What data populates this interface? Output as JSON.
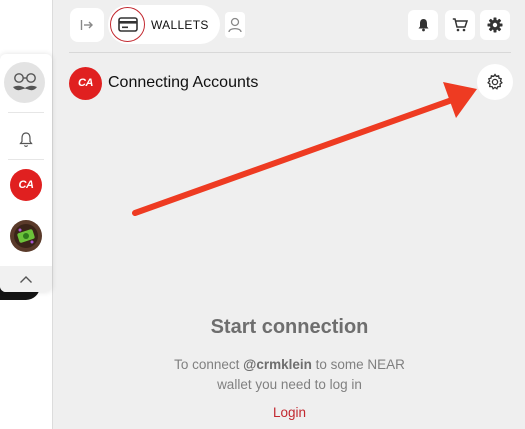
{
  "topbar": {
    "wallets_label": "WALLETS",
    "icons": {
      "collapse": "arrow-to-right-icon",
      "wallet": "wallet-card-icon",
      "profile": "user-icon",
      "bell": "bell-icon",
      "cart": "cart-icon",
      "gear": "gear-icon"
    }
  },
  "app": {
    "logo_text": "CA",
    "title": "Connecting Accounts",
    "settings_icon": "gear-outline-icon"
  },
  "content": {
    "title": "Start connection",
    "desc_prefix": "To connect ",
    "desc_user": "@crmklein",
    "desc_suffix": " to some NEAR",
    "desc_line2": "wallet you need to log in",
    "login_label": "Login"
  },
  "sidebar": {
    "app1_text": "CA",
    "icons": {
      "avatar": "mustache-glasses-avatar-icon",
      "bell": "bell-outline-icon",
      "app2": "game-app-icon",
      "up": "chevron-up-icon"
    }
  },
  "colors": {
    "brand_red": "#e02020",
    "accent_red": "#c2282f",
    "panel_bg": "#efefef",
    "annotation_arrow": "#ee3b22"
  }
}
